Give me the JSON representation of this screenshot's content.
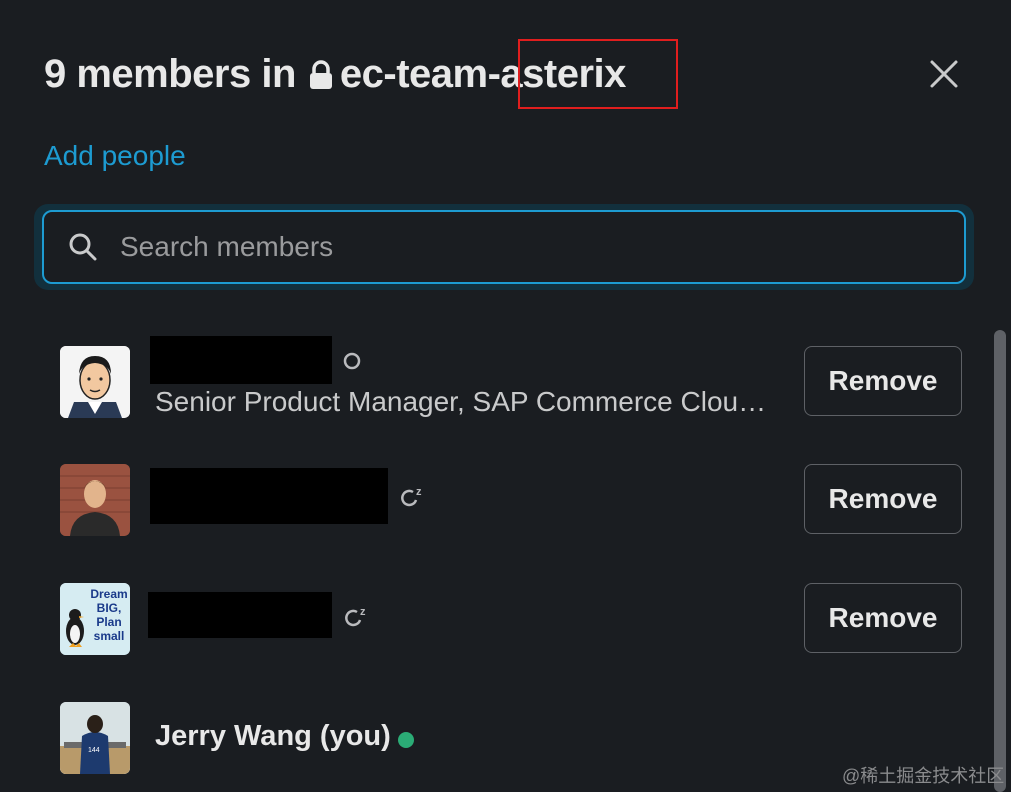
{
  "header": {
    "title_prefix": "9 members in",
    "channel_name": "ec-team-asterix",
    "close_label": "×"
  },
  "actions": {
    "add_people": "Add people"
  },
  "search": {
    "placeholder": "Search members",
    "value": ""
  },
  "members": [
    {
      "subtitle": "Senior Product Manager, SAP Commerce Clou…",
      "status": "away",
      "button": "Remove"
    },
    {
      "subtitle": "",
      "status": "snoozed",
      "button": "Remove"
    },
    {
      "subtitle": "",
      "status": "snoozed",
      "button": "Remove"
    },
    {
      "name": "Jerry Wang (you)",
      "status": "active"
    }
  ],
  "avatar3_text": "Dream BIG, Plan small",
  "watermark": "@稀土掘金技术社区",
  "colors": {
    "background": "#1a1d21",
    "link": "#1d9bd1",
    "focus_border": "#1d9bd1",
    "online": "#2bac76",
    "highlight": "#e01e1e"
  }
}
